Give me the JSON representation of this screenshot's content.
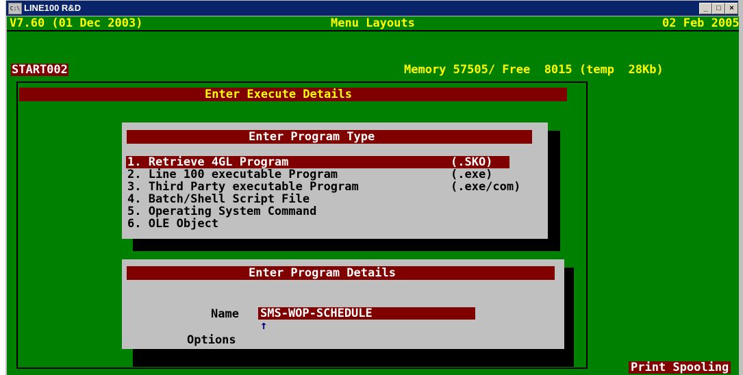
{
  "window": {
    "title": "LINE100 R&D",
    "icon": "console-icon",
    "buttons": {
      "minimize": "_",
      "maximize": "□",
      "close": "×"
    }
  },
  "header": {
    "version": "V7.60 (01 Dec 2003)",
    "screen_title": "Menu Layouts",
    "date": "02 Feb 2005",
    "program_id": "START002",
    "memory": "Memory 57505/ Free  8015 (temp  28Kb)"
  },
  "execute_panel": {
    "title": "Enter Execute Details"
  },
  "program_type": {
    "title": "Enter Program Type",
    "options": [
      {
        "label": "1. Retrieve 4GL Program",
        "ext": "(.SKO)"
      },
      {
        "label": "2. Line 100 executable Program",
        "ext": "(.exe)"
      },
      {
        "label": "3. Third Party executable Program",
        "ext": "(.exe/com)"
      },
      {
        "label": "4. Batch/Shell Script File",
        "ext": ""
      },
      {
        "label": "5. Operating System Command",
        "ext": ""
      },
      {
        "label": "6. OLE Object",
        "ext": ""
      }
    ]
  },
  "program_details": {
    "title": "Enter Program Details",
    "name_label": "Name",
    "name_value": "SMS-WOP-SCHEDULE",
    "cursor": "↑",
    "options_label": "Options"
  },
  "footer": {
    "status": "Print Spooling"
  }
}
